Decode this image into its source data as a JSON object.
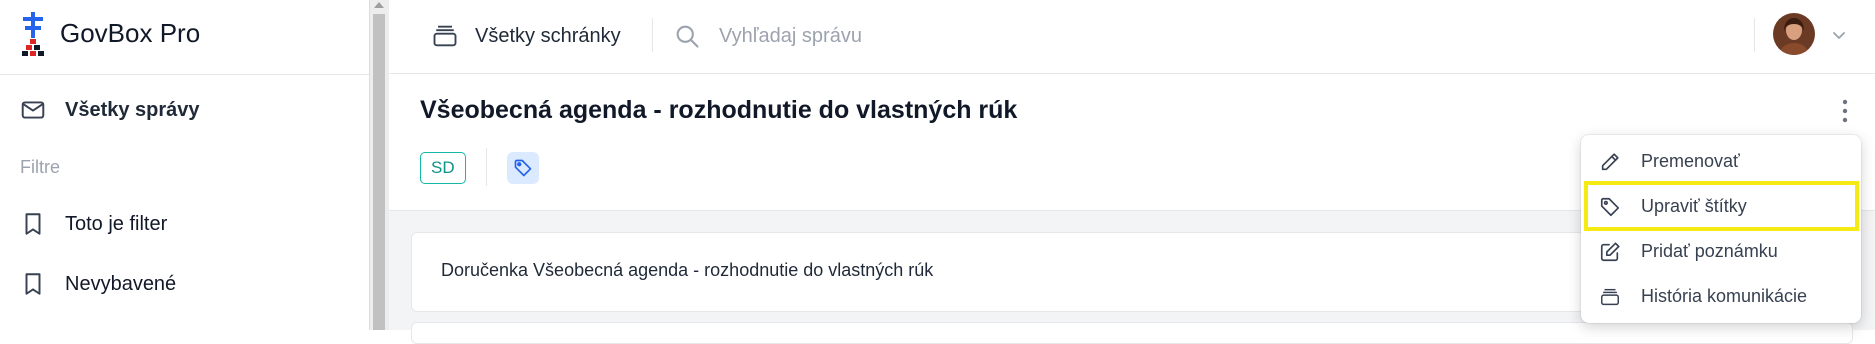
{
  "app": {
    "name": "GovBox Pro"
  },
  "sidebar": {
    "all_messages_label": "Všetky správy",
    "filters_title": "Filtre",
    "filters": [
      {
        "label": "Toto je filter"
      },
      {
        "label": "Nevybavené"
      }
    ]
  },
  "topbar": {
    "mailbox_label": "Všetky schránky",
    "search_placeholder": "Vyhľadaj správu"
  },
  "message": {
    "title": "Všeobecná agenda - rozhodnutie do vlastných rúk",
    "tag": "SD",
    "items": [
      {
        "text": "Doručenka Všeobecná agenda - rozhodnutie do vlastných rúk"
      }
    ]
  },
  "menu": {
    "items": [
      {
        "label": "Premenovať",
        "icon": "pencil-icon"
      },
      {
        "label": "Upraviť štítky",
        "icon": "tag-icon"
      },
      {
        "label": "Pridať poznámku",
        "icon": "edit-note-icon"
      },
      {
        "label": "História komunikácie",
        "icon": "archive-icon"
      }
    ],
    "highlighted_index": 1
  },
  "colors": {
    "accent": "#14b8a6",
    "highlight": "#f5ea14",
    "tag_bg": "#dbeafe",
    "tag_icon": "#2563eb"
  }
}
